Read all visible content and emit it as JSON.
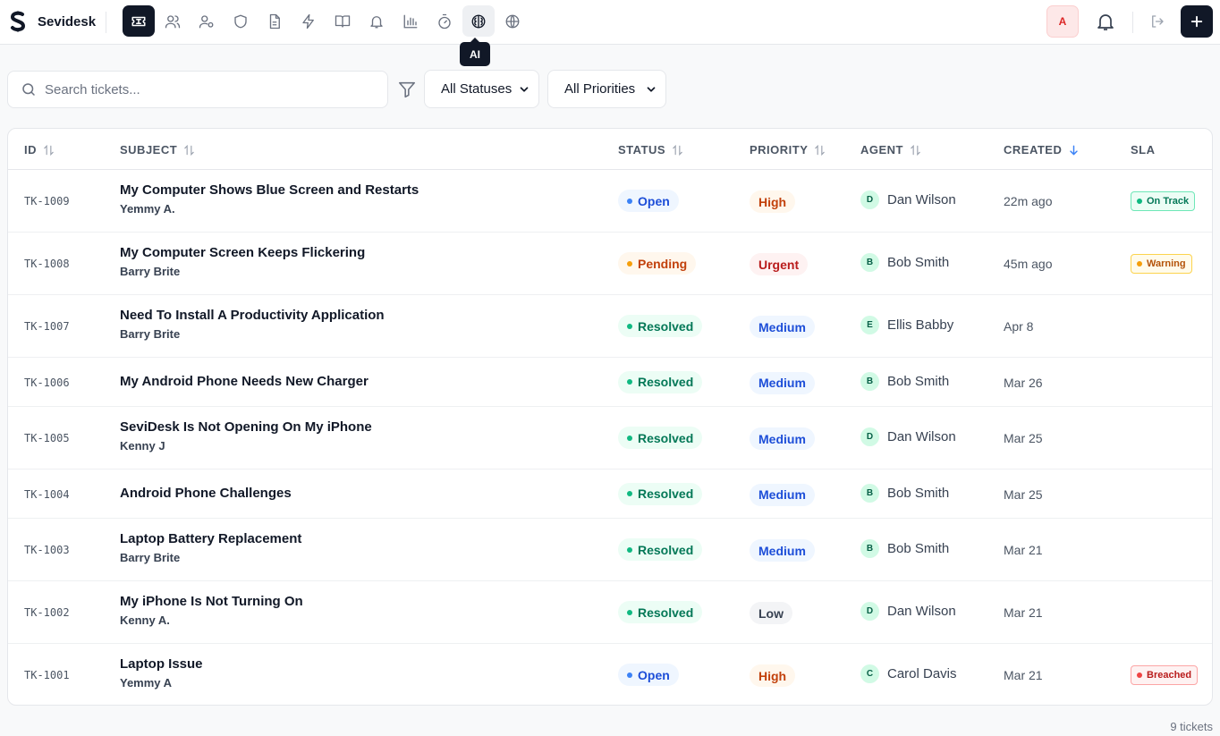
{
  "app": {
    "name": "Sevidesk"
  },
  "nav": {
    "tooltip": "AI",
    "items": [
      {
        "icon": "tickets-icon",
        "active": true
      },
      {
        "icon": "users-icon"
      },
      {
        "icon": "user-settings-icon"
      },
      {
        "icon": "shield-icon"
      },
      {
        "icon": "document-icon"
      },
      {
        "icon": "lightning-icon"
      },
      {
        "icon": "book-icon"
      },
      {
        "icon": "bell-icon"
      },
      {
        "icon": "bar-chart-icon"
      },
      {
        "icon": "timer-icon"
      },
      {
        "icon": "brain-icon",
        "hover": true
      },
      {
        "icon": "globe-icon"
      }
    ]
  },
  "header_right": {
    "avatar_initial": "A"
  },
  "filters": {
    "search_placeholder": "Search tickets...",
    "status_value": "All Statuses",
    "priority_value": "All Priorities"
  },
  "table": {
    "columns": {
      "id": "ID",
      "subject": "SUBJECT",
      "status": "STATUS",
      "priority": "PRIORITY",
      "agent": "AGENT",
      "created": "CREATED",
      "sla": "SLA"
    },
    "rows": [
      {
        "id": "TK-1009",
        "subject": "My Computer Shows Blue Screen and Restarts",
        "requester": "Yemmy A.",
        "status": "Open",
        "priority": "High",
        "agent_initial": "D",
        "agent": "Dan Wilson",
        "created": "22m ago",
        "sla": "On Track"
      },
      {
        "id": "TK-1008",
        "subject": "My Computer Screen Keeps Flickering",
        "requester": "Barry Brite",
        "status": "Pending",
        "priority": "Urgent",
        "agent_initial": "B",
        "agent": "Bob Smith",
        "created": "45m ago",
        "sla": "Warning"
      },
      {
        "id": "TK-1007",
        "subject": "Need To Install A Productivity Application",
        "requester": "Barry Brite",
        "status": "Resolved",
        "priority": "Medium",
        "agent_initial": "E",
        "agent": "Ellis Babby",
        "created": "Apr 8",
        "sla": ""
      },
      {
        "id": "TK-1006",
        "subject": "My Android Phone Needs New Charger",
        "requester": "",
        "status": "Resolved",
        "priority": "Medium",
        "agent_initial": "B",
        "agent": "Bob Smith",
        "created": "Mar 26",
        "sla": ""
      },
      {
        "id": "TK-1005",
        "subject": "SeviDesk Is Not Opening On My iPhone",
        "requester": "Kenny J",
        "status": "Resolved",
        "priority": "Medium",
        "agent_initial": "D",
        "agent": "Dan Wilson",
        "created": "Mar 25",
        "sla": ""
      },
      {
        "id": "TK-1004",
        "subject": "Android Phone Challenges",
        "requester": "",
        "status": "Resolved",
        "priority": "Medium",
        "agent_initial": "B",
        "agent": "Bob Smith",
        "created": "Mar 25",
        "sla": ""
      },
      {
        "id": "TK-1003",
        "subject": "Laptop Battery Replacement",
        "requester": "Barry Brite",
        "status": "Resolved",
        "priority": "Medium",
        "agent_initial": "B",
        "agent": "Bob Smith",
        "created": "Mar 21",
        "sla": ""
      },
      {
        "id": "TK-1002",
        "subject": "My iPhone Is Not Turning On",
        "requester": "Kenny A.",
        "status": "Resolved",
        "priority": "Low",
        "agent_initial": "D",
        "agent": "Dan Wilson",
        "created": "Mar 21",
        "sla": ""
      },
      {
        "id": "TK-1001",
        "subject": "Laptop Issue",
        "requester": "Yemmy A",
        "status": "Open",
        "priority": "High",
        "agent_initial": "C",
        "agent": "Carol Davis",
        "created": "Mar 21",
        "sla": "Breached"
      }
    ]
  },
  "footer": {
    "count": "9 tickets"
  },
  "colors": {
    "status": {
      "Open": {
        "bg": "#eff6ff",
        "fg": "#1d4ed8",
        "dot": "#3b82f6"
      },
      "Pending": {
        "bg": "#fff7ed",
        "fg": "#c2410c",
        "dot": "#f59e0b"
      },
      "Resolved": {
        "bg": "#ecfdf5",
        "fg": "#047857",
        "dot": "#10b981"
      }
    },
    "priority": {
      "High": {
        "bg": "#fff7ed",
        "fg": "#c2410c"
      },
      "Urgent": {
        "bg": "#fef2f2",
        "fg": "#b91c1c"
      },
      "Medium": {
        "bg": "#eff6ff",
        "fg": "#1d4ed8"
      },
      "Low": {
        "bg": "#f3f4f6",
        "fg": "#374151"
      }
    },
    "sla": {
      "On Track": {
        "bg": "#ecfdf5",
        "fg": "#047857",
        "border": "#6ee7b7",
        "dot": "#10b981"
      },
      "Warning": {
        "bg": "#fffbeb",
        "fg": "#b45309",
        "border": "#fcd34d",
        "dot": "#f59e0b"
      },
      "Breached": {
        "bg": "#fef2f2",
        "fg": "#b91c1c",
        "border": "#fca5a5",
        "dot": "#ef4444"
      }
    }
  }
}
